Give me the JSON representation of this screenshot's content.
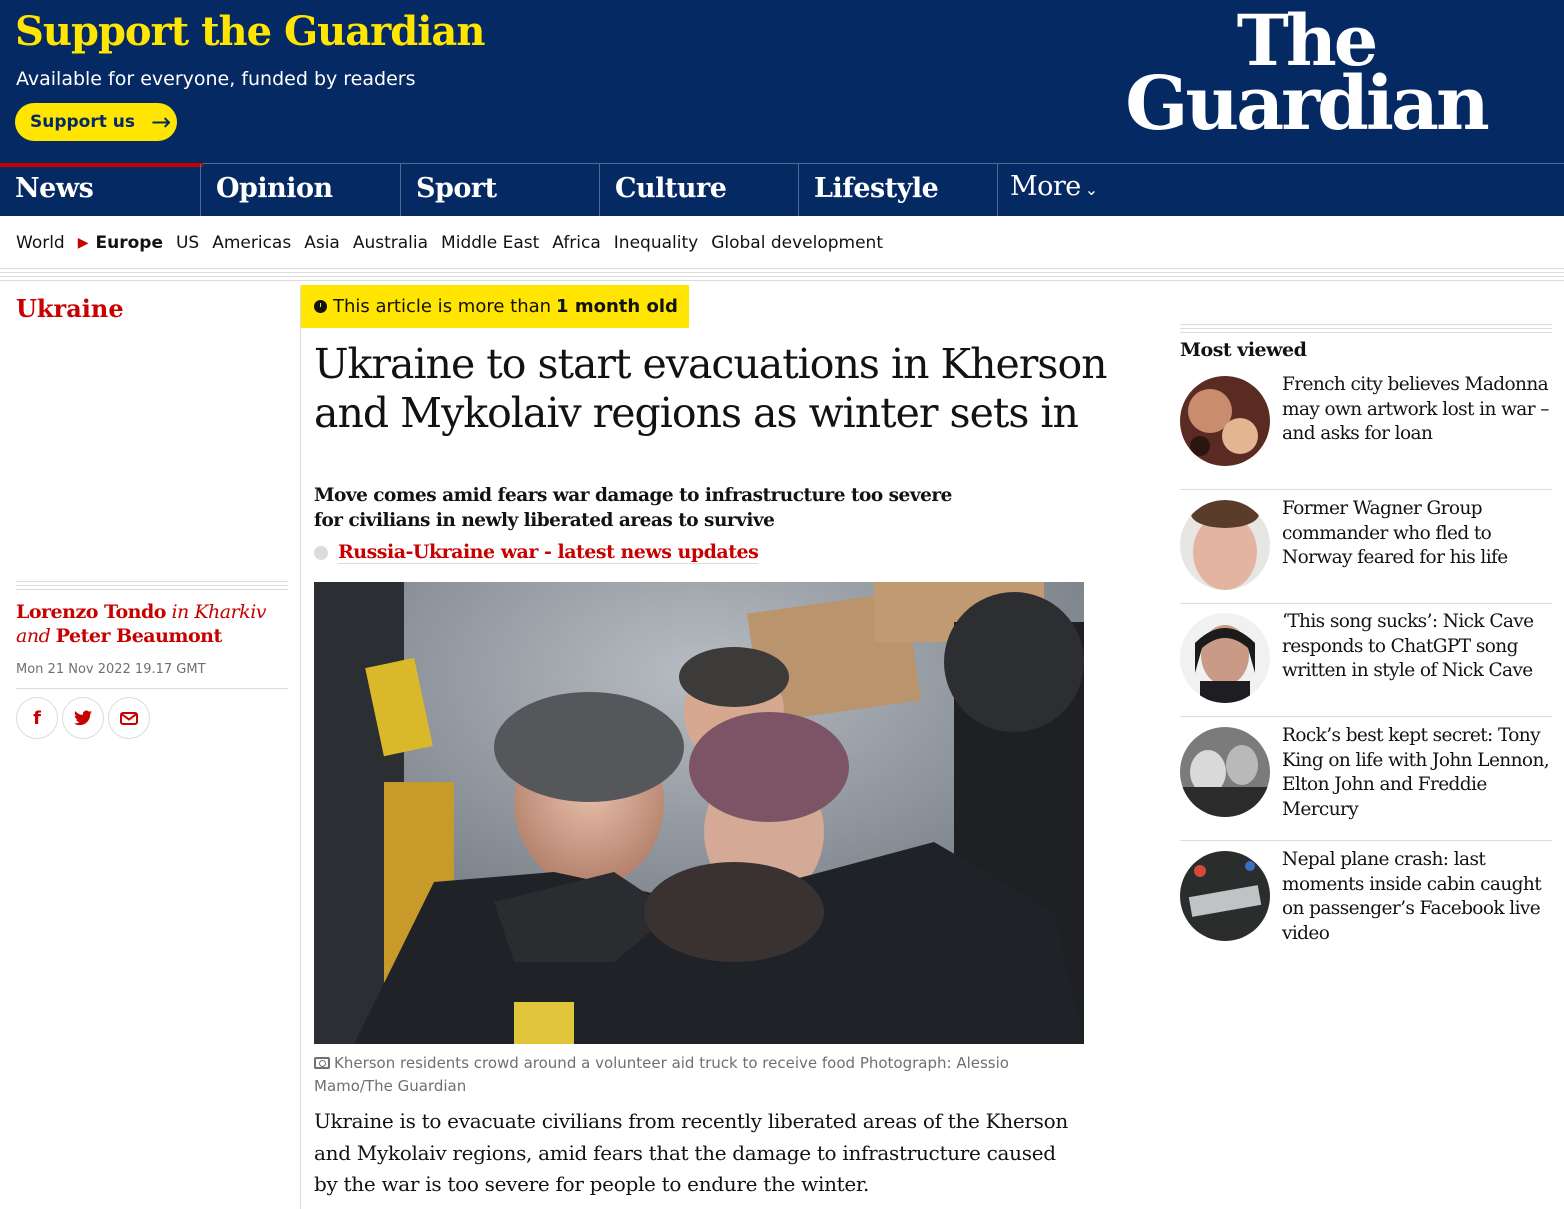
{
  "header": {
    "support_title": "Support the Guardian",
    "support_sub": "Available for everyone, funded by readers",
    "support_button": "Support us",
    "logo_line1": "The",
    "logo_line2": "Guardian"
  },
  "nav": {
    "items": [
      "News",
      "Opinion",
      "Sport",
      "Culture",
      "Lifestyle"
    ],
    "more": "More"
  },
  "subnav": {
    "items": [
      "World",
      "Europe",
      "US",
      "Americas",
      "Asia",
      "Australia",
      "Middle East",
      "Africa",
      "Inequality",
      "Global development"
    ],
    "current": "Europe"
  },
  "article": {
    "kicker": "Ukraine",
    "age_prefix": "This article is more than",
    "age_bold": "1 month old",
    "headline": "Ukraine to start evacuations in Kherson and Mykolaiv regions as winter sets in",
    "standfirst": "Move comes amid fears war damage to infrastructure too severe for civilians in newly liberated areas to survive",
    "live_link": "Russia-Ukraine war - latest news updates",
    "byline": {
      "author1": "Lorenzo Tondo",
      "loc1": "in Kharkiv",
      "and": "and",
      "author2": "Peter Beaumont"
    },
    "dateline": "Mon 21 Nov 2022 19.17 GMT",
    "caption": "Kherson residents crowd around a volunteer aid truck to receive food Photograph: Alessio Mamo/The Guardian",
    "body": "Ukraine is to evacuate civilians from recently liberated areas of the Kherson and Mykolaiv regions, amid fears that the damage to infrastructure caused by the war is too severe for people to endure the winter."
  },
  "share": {
    "icons": [
      "facebook-icon",
      "twitter-icon",
      "email-icon"
    ],
    "facebook": "f",
    "twitter": "t"
  },
  "most_viewed": {
    "title": "Most viewed",
    "items": [
      "French city believes Madonna may own artwork lost in war – and asks for loan",
      "Former Wagner Group commander who fled to Norway feared for his life",
      "‘This song sucks’: Nick Cave responds to ChatGPT song written in style of Nick Cave",
      "Rock’s best kept secret: Tony King on life with John Lennon, Elton John and Freddie Mercury",
      "Nepal plane crash: last moments inside cabin caught on passenger’s Facebook live video"
    ]
  },
  "colors": {
    "brand_blue": "#052962",
    "brand_yellow": "#ffe500",
    "news_red": "#c70000"
  }
}
